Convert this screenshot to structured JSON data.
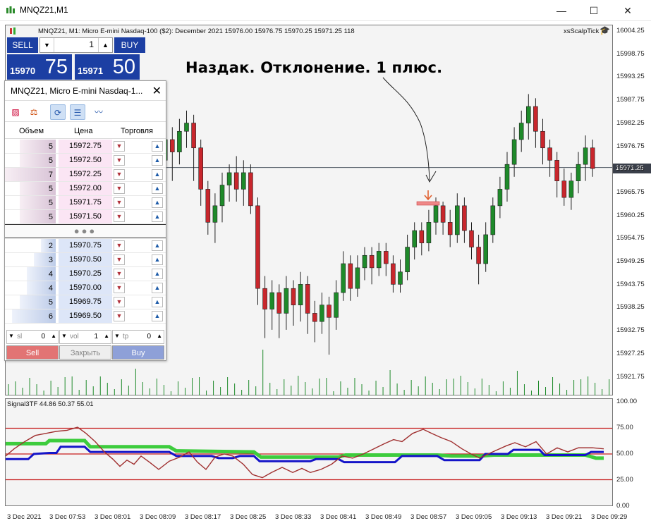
{
  "window": {
    "title": "MNQZ21,M1",
    "min": "—",
    "max": "☐",
    "close": "✕"
  },
  "chart": {
    "info": "MNQZ21, M1:  Micro E-mini Nasdaq-100 ($2): December 2021  15976.00  15976.75  15970.25  15971.25  118",
    "indicator_name": "xsScalpTick",
    "annotation": "Наздак. Отклонение. 1 плюс.",
    "last_price": "15971.25",
    "price_ticks": [
      "16004.25",
      "15998.75",
      "15993.25",
      "15987.75",
      "15982.25",
      "15976.75",
      "15971.25",
      "15965.75",
      "15960.25",
      "15954.75",
      "15949.25",
      "15943.75",
      "15938.25",
      "15932.75",
      "15927.25",
      "15921.75"
    ],
    "time_ticks": [
      "3 Dec 2021",
      "3 Dec 07:53",
      "3 Dec 08:01",
      "3 Dec 08:09",
      "3 Dec 08:17",
      "3 Dec 08:25",
      "3 Dec 08:33",
      "3 Dec 08:41",
      "3 Dec 08:49",
      "3 Dec 08:57",
      "3 Dec 09:05",
      "3 Dec 09:13",
      "3 Dec 09:21",
      "3 Dec 09:29"
    ],
    "sub_title": "Signal3TF 44.86 50.37 55.01",
    "sub_ticks": [
      "100.00",
      "75.00",
      "50.00",
      "25.00",
      "0.00"
    ],
    "colors": {
      "bull": "#1e8a2a",
      "bear": "#c8262c",
      "green_line": "#3dcc3d",
      "blue_line": "#1414c8",
      "brown_line": "#a03030",
      "level_line": "#c81e1e"
    }
  },
  "one_click": {
    "sell": "SELL",
    "buy": "BUY",
    "qty": "1",
    "sell_small": "15970",
    "sell_big": "75",
    "buy_small": "15971",
    "buy_big": "50"
  },
  "dom": {
    "title": "MNQZ21, Micro E-mini Nasdaq-1...",
    "col_volume": "Объем",
    "col_price": "Цена",
    "col_trade": "Торговля",
    "asks": [
      {
        "vol": "5",
        "price": "15972.75"
      },
      {
        "vol": "5",
        "price": "15972.50"
      },
      {
        "vol": "7",
        "price": "15972.25"
      },
      {
        "vol": "5",
        "price": "15972.00"
      },
      {
        "vol": "5",
        "price": "15971.75"
      },
      {
        "vol": "5",
        "price": "15971.50"
      }
    ],
    "bids": [
      {
        "vol": "2",
        "price": "15970.75"
      },
      {
        "vol": "3",
        "price": "15970.50"
      },
      {
        "vol": "4",
        "price": "15970.25"
      },
      {
        "vol": "4",
        "price": "15970.00"
      },
      {
        "vol": "5",
        "price": "15969.75"
      },
      {
        "vol": "6",
        "price": "15969.50"
      }
    ],
    "sl_label": "sl",
    "sl_value": "0",
    "vol_label": "vol",
    "vol_value": "1",
    "tp_label": "tp",
    "tp_value": "0",
    "sell": "Sell",
    "close": "Закрыть",
    "buy": "Buy"
  }
}
